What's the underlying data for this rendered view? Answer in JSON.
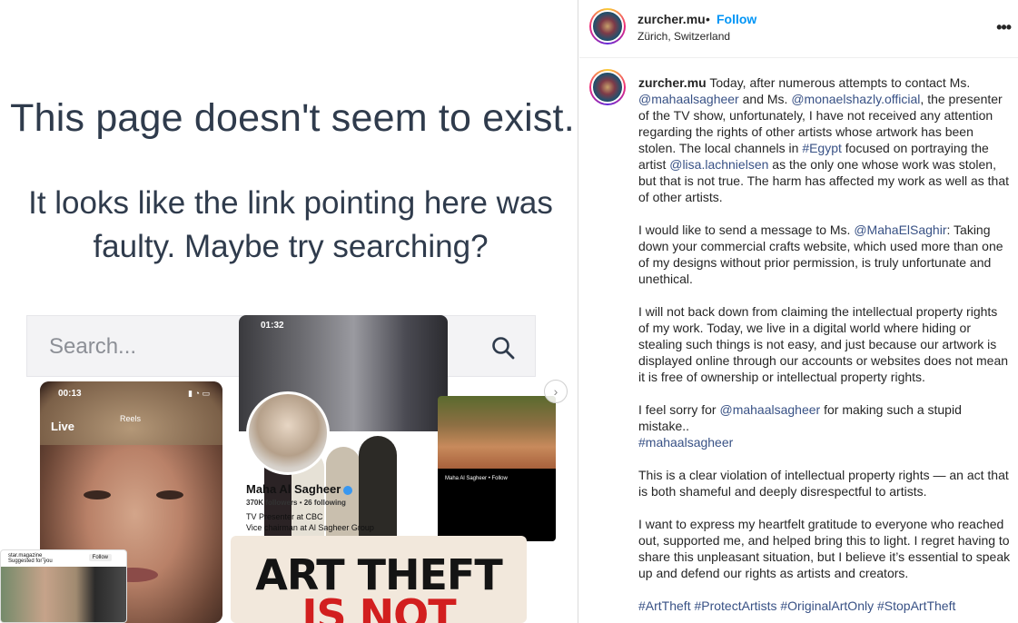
{
  "media": {
    "notfound_title": "This page doesn't seem to exist.",
    "notfound_sub": "It looks like the link pointing here was faulty. Maybe try searching?",
    "search_placeholder": "Search...",
    "phone_left": {
      "time": "00:13",
      "live": "Live",
      "reels": "Reels"
    },
    "phone_mid": {
      "time": "01:32",
      "name": "Maha Al Sagheer",
      "followers": "370K followers",
      "following": "26 following",
      "bio1": "TV Presenter at CBC",
      "bio2": "Vice chairman at Al Sagheer Group"
    },
    "phone_right": {
      "caption": "Maha Al Sagheer • Follow"
    },
    "small_card": {
      "handle": "star.magazine_",
      "suggested": "Suggested for you",
      "follow": "Follow"
    },
    "poster": {
      "line1": "ART THEFT",
      "line2": "IS NOT"
    }
  },
  "post": {
    "username": "zurcher.mu",
    "follow": "Follow",
    "location": "Zürich, Switzerland",
    "caption": {
      "p1": {
        "t1": "Today, after numerous attempts to contact Ms.",
        "m1": "@mahaalsagheer",
        "t2": "and Ms.",
        "m2": "@monaelshazly.official",
        "t3": ", the presenter of the TV show, unfortunately, I have not received any attention regarding the rights of other artists whose artwork has been stolen. The local channels in",
        "h1": "#Egypt",
        "t4": "focused on portraying the artist",
        "m3": "@lisa.lachnielsen",
        "t5": "as the only one whose work was stolen, but that is not true. The harm has affected my work as well as that of other artists."
      },
      "p2": {
        "t1": "I would like to send a message to Ms.",
        "m1": "@MahaElSaghir",
        "t2": ": Taking down your commercial crafts website, which used more than one of my designs without prior permission, is truly unfortunate and unethical."
      },
      "p3": "I will not back down from claiming the intellectual property rights of my work. Today, we live in a digital world where hiding or stealing such things is not easy, and just because our artwork is displayed online through our accounts or websites does not mean it is free of ownership or intellectual property rights.",
      "p4": {
        "t1": "I feel sorry for",
        "m1": "@mahaalsagheer",
        "t2": "for making such a stupid mistake..",
        "h1": "#mahaalsagheer"
      },
      "p5": "This is a clear violation of intellectual property rights — an act that is both shameful and deeply disrespectful to artists.",
      "p6": "I want to express my heartfelt gratitude to everyone who reached out, supported me, and helped bring this to light. I regret having to share this unpleasant situation, but I believe it’s essential to speak up and defend our rights as artists and creators.",
      "hashtags": "#ArtTheft #ProtectArtists #OriginalArtOnly #StopArtTheft"
    }
  },
  "colors": {
    "link": "#385185",
    "follow": "#0095f6",
    "poster_red": "#d21f1f"
  }
}
